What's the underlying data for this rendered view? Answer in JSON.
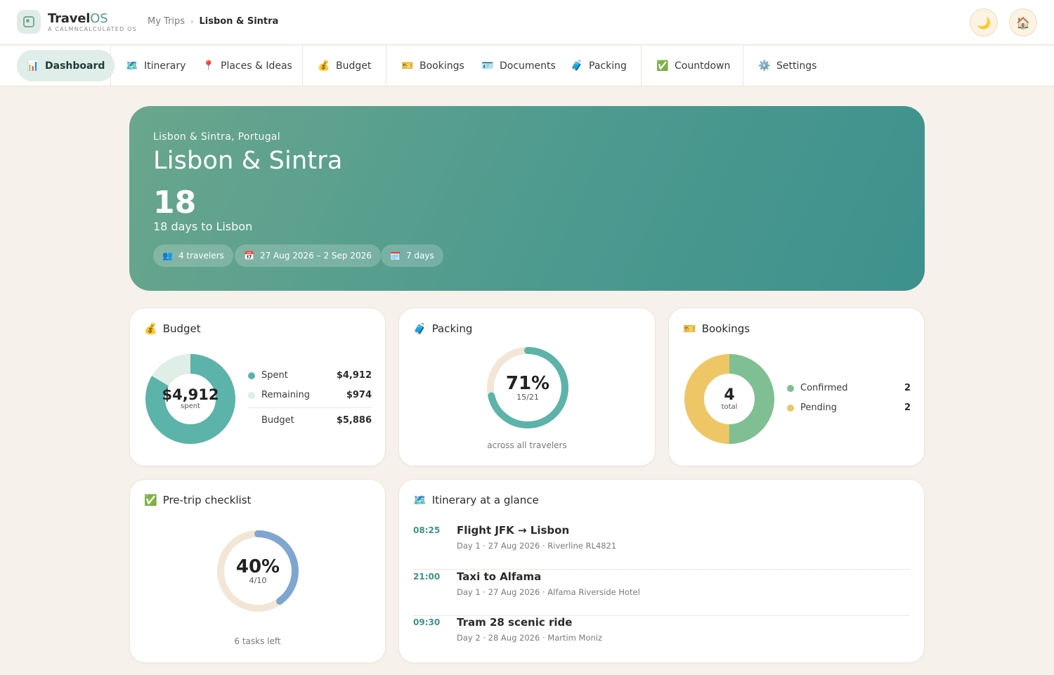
{
  "app": {
    "brand_main": "Travel",
    "brand_accent": "OS",
    "brand_sub": "A calmncalculated OS",
    "breadcrumb": [
      "My Trips",
      "Lisbon & Sintra"
    ],
    "theme_icon": "moon-icon",
    "home_icon": "house-icon"
  },
  "nav": [
    {
      "label": "Dashboard",
      "icon": "📊",
      "active": true
    },
    {
      "label": "Itinerary",
      "icon": "🗺️"
    },
    {
      "label": "Places & Ideas",
      "icon": "📍"
    },
    {
      "label": "Budget",
      "icon": "💰"
    },
    {
      "label": "Bookings",
      "icon": "🎫"
    },
    {
      "label": "Documents",
      "icon": "🪪"
    },
    {
      "label": "Packing",
      "icon": "🧳"
    },
    {
      "label": "Countdown",
      "icon": "✅"
    },
    {
      "label": "Settings",
      "icon": "⚙️"
    }
  ],
  "hero": {
    "location": "Lisbon & Sintra, Portugal",
    "title": "Lisbon & Sintra",
    "countdown": "18",
    "countdown_label": "18 days to Lisbon",
    "pills": [
      {
        "icon": "👥",
        "label": "4 travelers"
      },
      {
        "icon": "📅",
        "label": "27 Aug 2026 – 2 Sep 2026"
      },
      {
        "icon": "🗓️",
        "label": "7 days"
      }
    ]
  },
  "budget": {
    "icon": "💰",
    "title": "Budget",
    "center_value": "$4,912",
    "center_label": "spent",
    "spent_fraction": 0.8345,
    "legend": [
      {
        "label": "Spent",
        "value": "$4,912",
        "color": "#5bb3a9"
      },
      {
        "label": "Remaining",
        "value": "$974",
        "color": "#dfeee6"
      }
    ],
    "total_label": "Budget",
    "total_value": "$5,886"
  },
  "packing": {
    "icon": "🧳",
    "title": "Packing",
    "percent": "71%",
    "count": "15/21",
    "fraction": 0.714,
    "caption": "across all travelers"
  },
  "bookings": {
    "icon": "🎫",
    "title": "Bookings",
    "center_value": "4",
    "center_label": "total",
    "legend": [
      {
        "label": "Confirmed",
        "value": "2",
        "color": "#7fbf93"
      },
      {
        "label": "Pending",
        "value": "2",
        "color": "#efc665"
      }
    ]
  },
  "checklist": {
    "icon": "✅",
    "title": "Pre-trip checklist",
    "percent": "40%",
    "count": "4/10",
    "fraction": 0.4,
    "caption": "6 tasks left"
  },
  "itinerary": {
    "icon": "🗺️",
    "title": "Itinerary at a glance",
    "rows": [
      {
        "time": "08:25",
        "name": "Flight JFK → Lisbon",
        "meta": "Day 1 · 27 Aug 2026 · Riverline RL4821"
      },
      {
        "time": "21:00",
        "name": "Taxi to Alfama",
        "meta": "Day 1 · 27 Aug 2026 · Alfama Riverside Hotel"
      },
      {
        "time": "09:30",
        "name": "Tram 28 scenic ride",
        "meta": "Day 2 · 28 Aug 2026 · Martim Moniz"
      }
    ]
  }
}
